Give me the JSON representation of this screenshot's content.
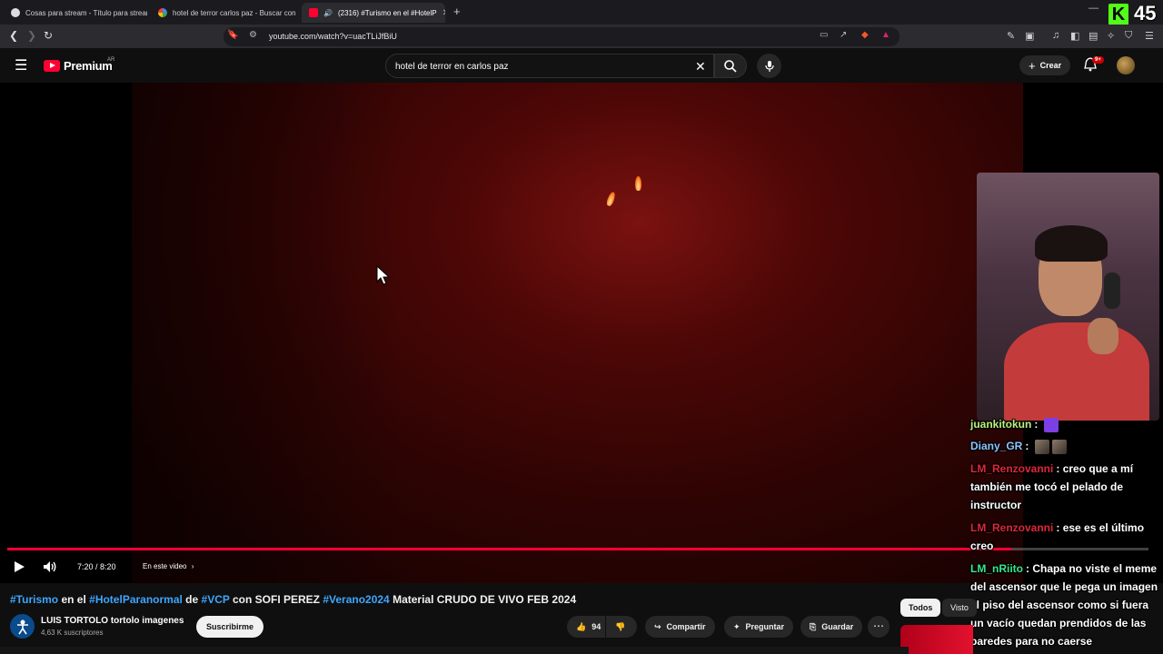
{
  "browser": {
    "tabs": [
      {
        "title": "Cosas para stream - Título para stream",
        "active": false
      },
      {
        "title": "hotel de terror carlos paz - Buscar con",
        "active": false
      },
      {
        "title": "(2316) #Turismo en el #HotelP",
        "active": true
      }
    ],
    "new_tab": "+",
    "url": "youtube.com/watch?v=uacTLiJfBiU",
    "stream_counter": "45"
  },
  "youtube": {
    "brand": "Premium",
    "country": "AR",
    "search_query": "hotel de terror en carlos paz",
    "create_label": "Crear",
    "notifications_badge": "9+"
  },
  "player": {
    "time": "7:20 / 8:20",
    "chapter_label": "En este video",
    "progress_fraction": 0.88
  },
  "video": {
    "title_parts": [
      {
        "text": "#Turismo",
        "hashtag": true
      },
      {
        "text": " en el ",
        "hashtag": false
      },
      {
        "text": "#HotelParanormal",
        "hashtag": true
      },
      {
        "text": " de ",
        "hashtag": false
      },
      {
        "text": "#VCP",
        "hashtag": true
      },
      {
        "text": " con SOFI PEREZ ",
        "hashtag": false
      },
      {
        "text": "#Verano2024",
        "hashtag": true
      },
      {
        "text": " Material CRUDO DE VIVO FEB 2024",
        "hashtag": false
      }
    ],
    "channel_name": "LUIS TORTOLO tortolo imagenes",
    "subscribers": "4,63 K suscriptores",
    "subscribe_label": "Suscribirme",
    "likes": "94",
    "share_label": "Compartir",
    "ask_label": "Preguntar",
    "save_label": "Guardar"
  },
  "sidebar_chips": [
    "Todos",
    "Visto"
  ],
  "chat": [
    {
      "user": "juankitokun",
      "color": "#b9f27c",
      "message": ""
    },
    {
      "user": "Diany_GR",
      "color": "#8ec5ff",
      "message": ""
    },
    {
      "user": "LM_Renzovanni",
      "color": "#e0263a",
      "message": "creo que a mí también me tocó el pelado de instructor"
    },
    {
      "user": "LM_Renzovanni",
      "color": "#e0263a",
      "message": "ese es el último creo"
    },
    {
      "user": "LM_nRiito",
      "color": "#39e58c",
      "message": "Chapa no viste el meme del ascensor que le pega un imagen al piso del ascensor como si fuera un vacío quedan prendidos de las paredes para no caerse"
    }
  ]
}
